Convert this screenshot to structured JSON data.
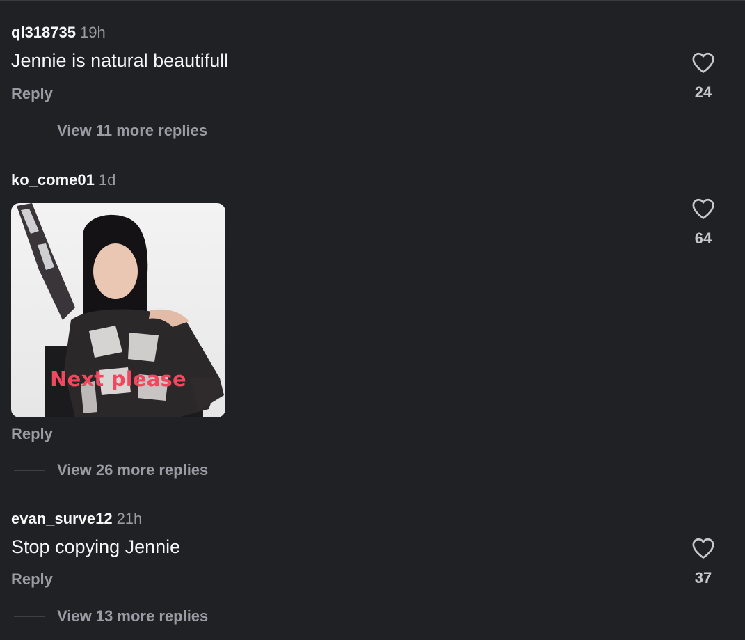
{
  "colors": {
    "background": "#202125",
    "username": "#f7f7f8",
    "muted": "#9a9ca3",
    "sticker_text": "#f0485e"
  },
  "comments": [
    {
      "username": "ql318735",
      "time": "19h",
      "text": "Jennie is natural beautifull",
      "reply_label": "Reply",
      "likes": "24",
      "view_more": "View 11 more replies",
      "like_icon": "heart-outline-icon"
    },
    {
      "username": "ko_come01",
      "time": "1d",
      "media_caption": "Next please",
      "reply_label": "Reply",
      "likes": "64",
      "view_more": "View 26 more replies",
      "like_icon": "heart-outline-icon"
    },
    {
      "username": "evan_surve12",
      "time": "21h",
      "text": "Stop copying Jennie",
      "reply_label": "Reply",
      "likes": "37",
      "view_more": "View 13 more replies",
      "like_icon": "heart-outline-icon"
    }
  ]
}
